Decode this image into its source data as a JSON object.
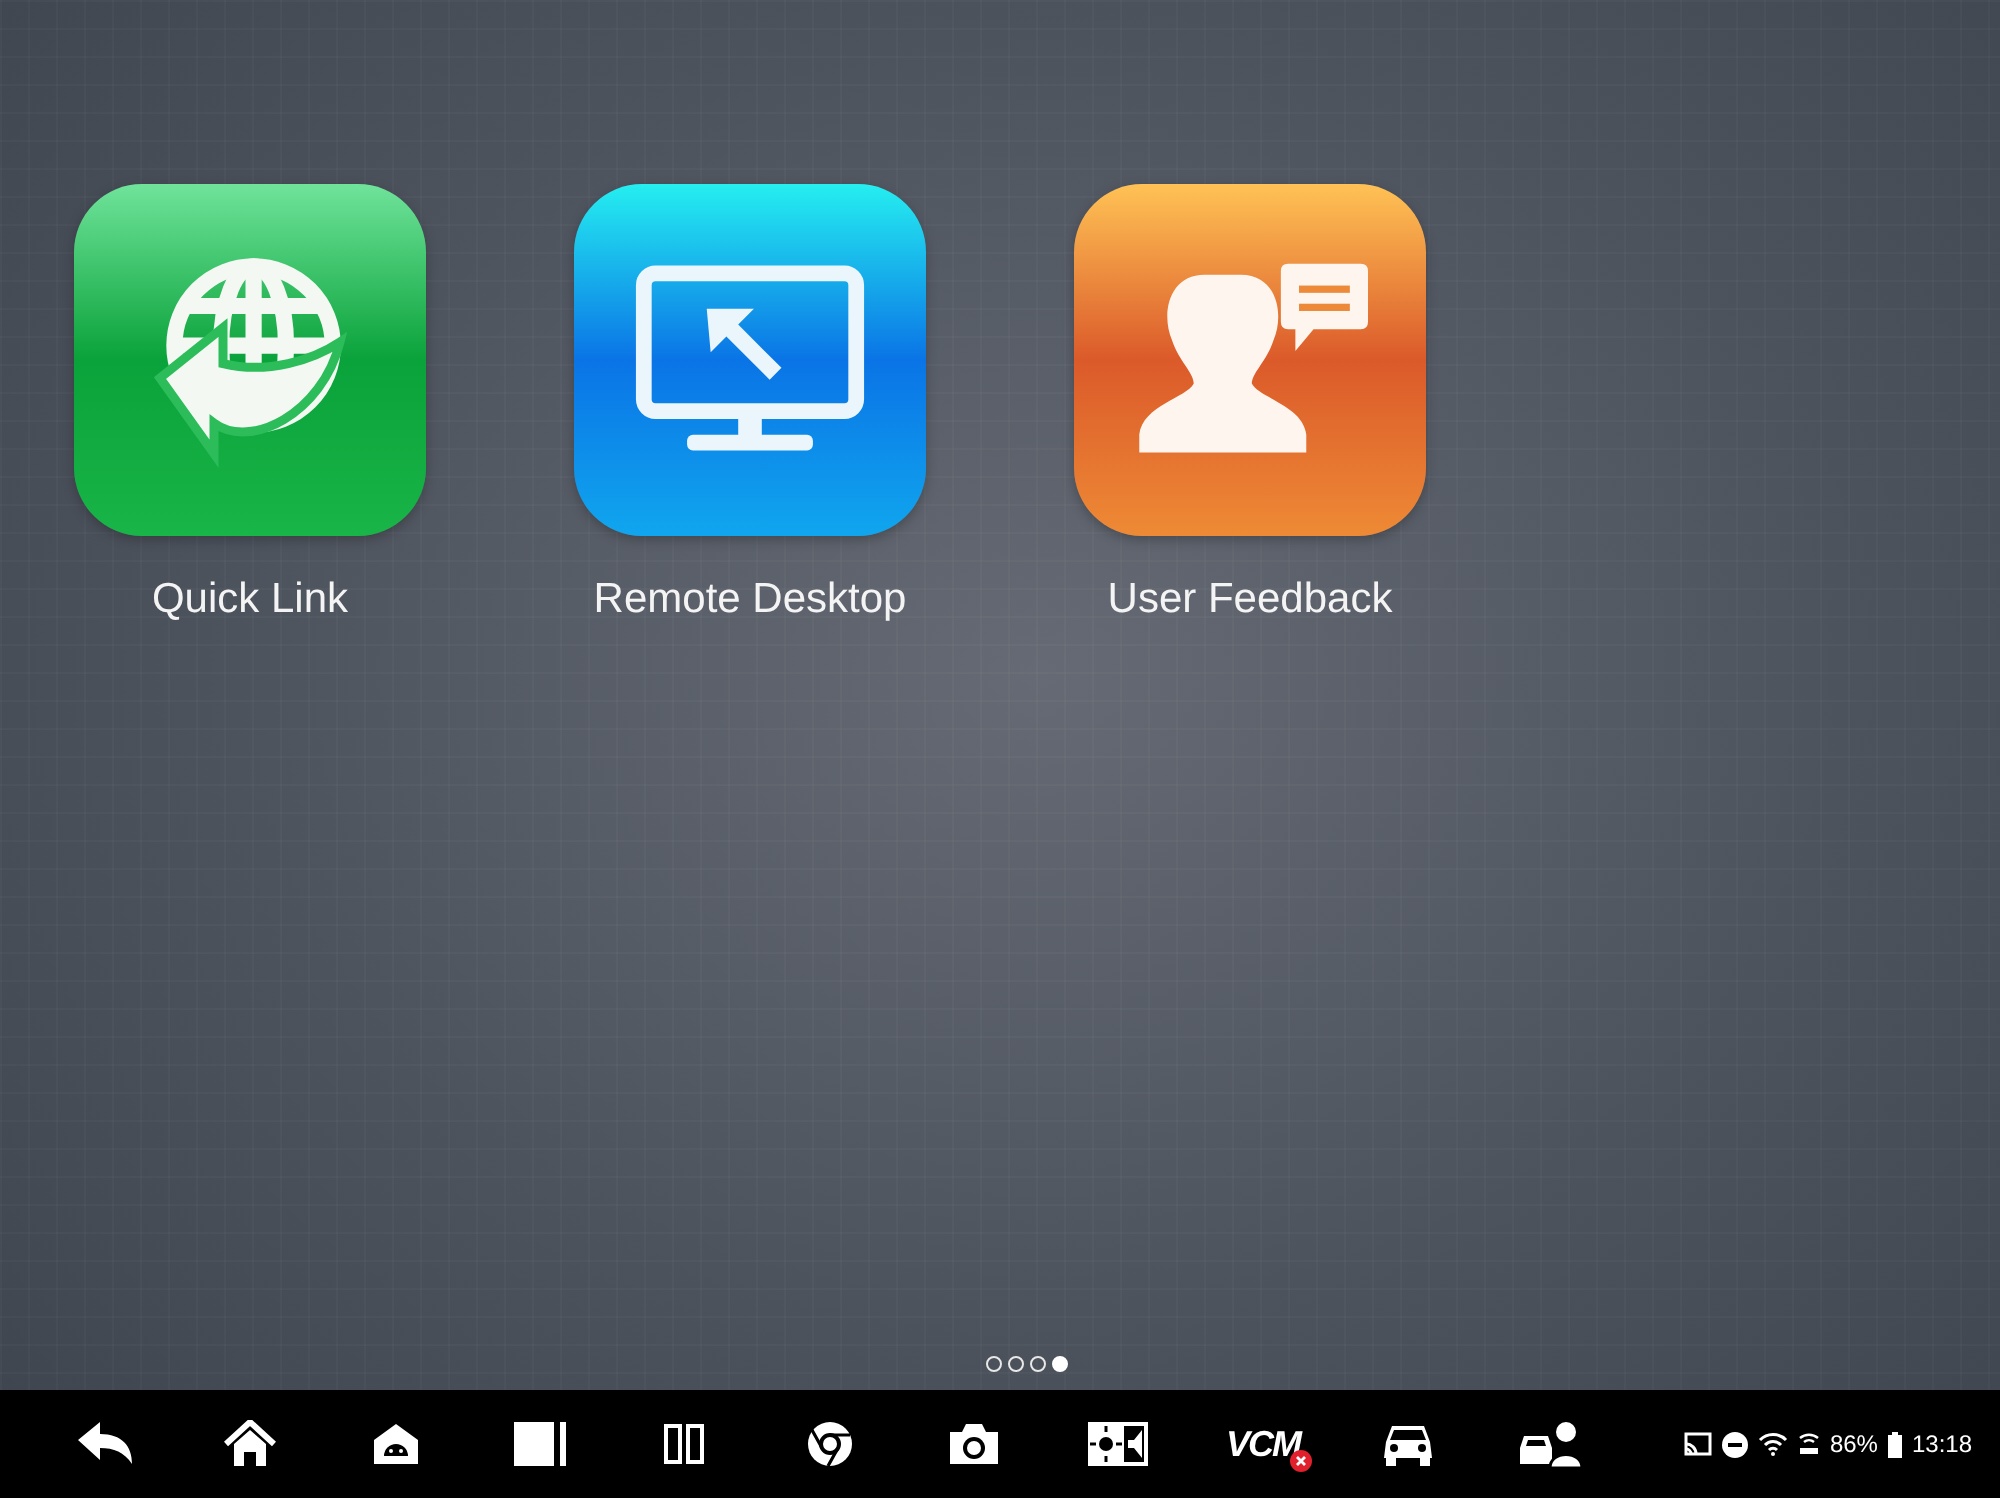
{
  "apps": [
    {
      "kind": "globe",
      "label": "Quick Link",
      "color": "#19b548"
    },
    {
      "kind": "desktop",
      "label": "Remote Desktop",
      "color": "#10a6ee"
    },
    {
      "kind": "feedback",
      "label": "User Feedback",
      "color": "#ee8a35"
    }
  ],
  "page_dots": [
    {
      "selected": false
    },
    {
      "selected": false
    },
    {
      "selected": false
    },
    {
      "selected": true
    }
  ],
  "taskbar": {
    "buttons": [
      {
        "kind": "back"
      },
      {
        "kind": "home"
      },
      {
        "kind": "android"
      },
      {
        "kind": "window"
      },
      {
        "kind": "split"
      },
      {
        "kind": "browser"
      },
      {
        "kind": "camera"
      },
      {
        "kind": "brightness"
      },
      {
        "kind": "vcm",
        "label": "VCM"
      },
      {
        "kind": "car"
      },
      {
        "kind": "service"
      }
    ],
    "status": {
      "battery": "86%",
      "time": "13:18"
    }
  }
}
